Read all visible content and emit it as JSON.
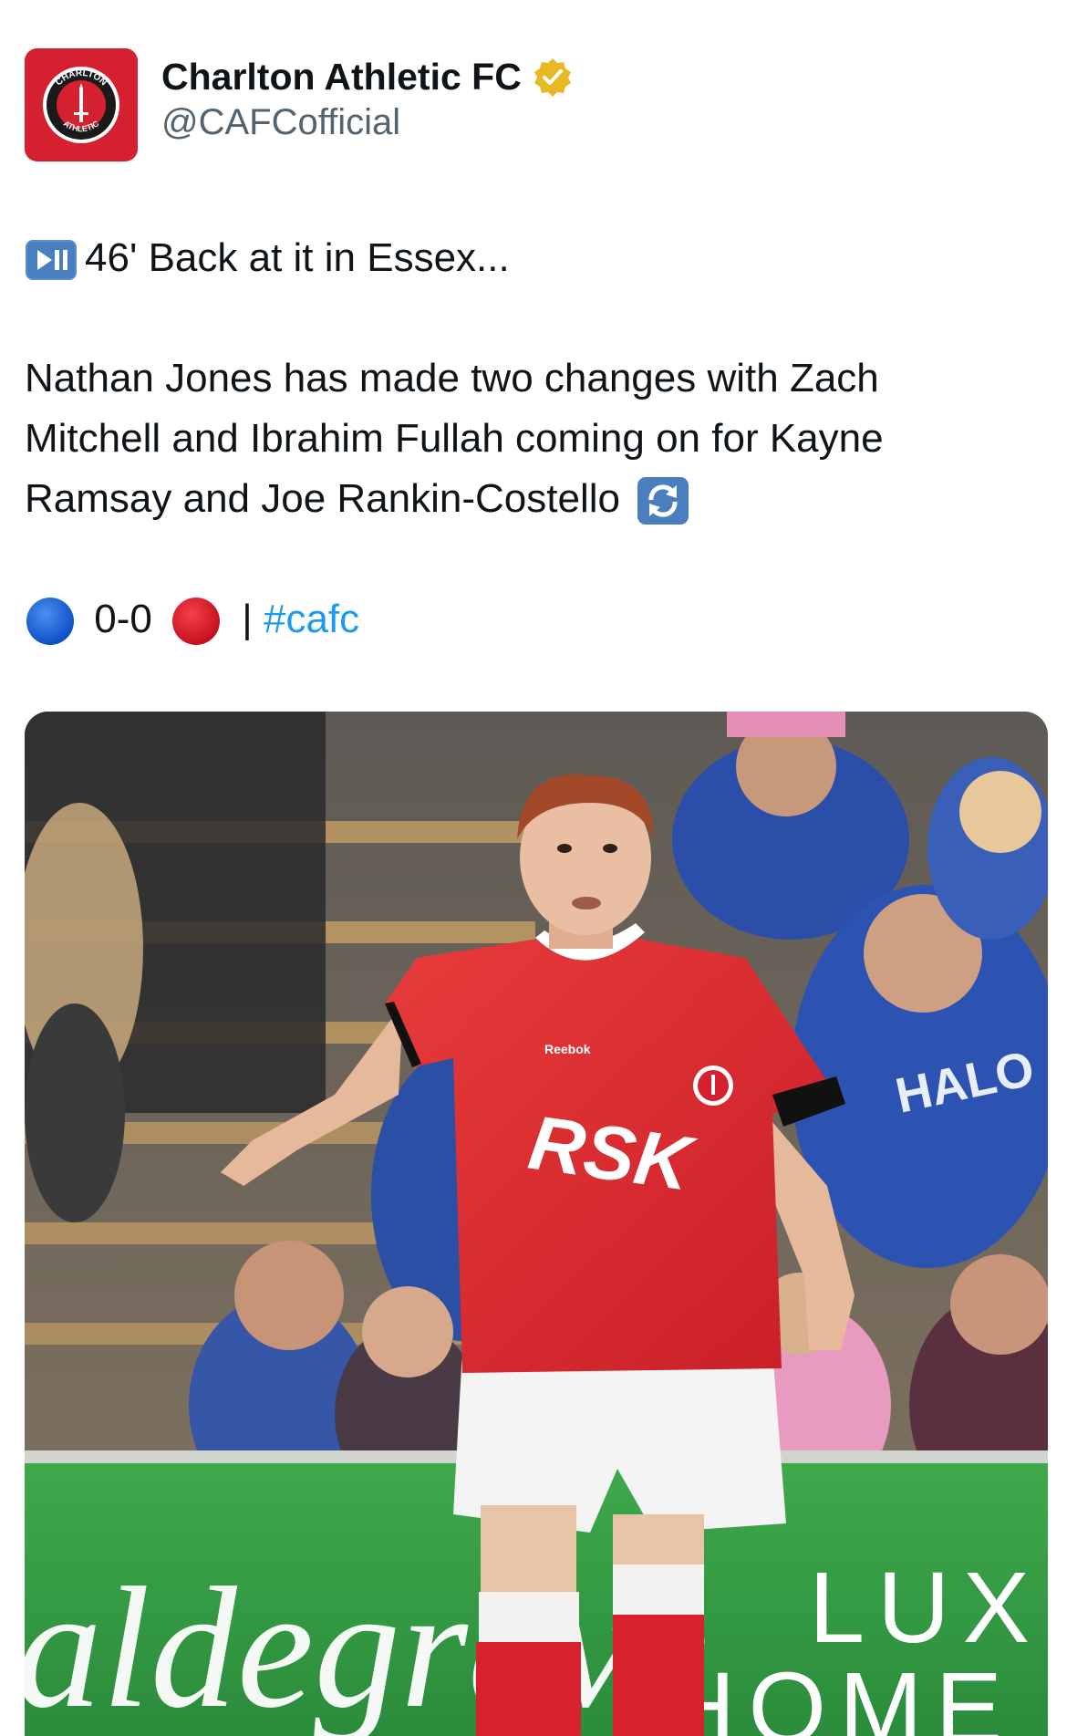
{
  "account": {
    "display_name": "Charlton Athletic FC",
    "handle": "@CAFCofficial",
    "verified": true,
    "avatar_icon": "charlton-crest-icon",
    "avatar_text_top": "CHARLTON",
    "avatar_text_bottom": "ATHLETIC"
  },
  "tweet": {
    "line1": "46' Back at it in Essex...",
    "line2": "Nathan Jones has made two changes with Zach",
    "line3": "Mitchell and Ibrahim Fullah coming on for Kayne",
    "line4": "Ramsay and Joe Rankin-Costello",
    "score": "0-0",
    "separator": "|",
    "hashtag": "#cafc"
  },
  "media": {
    "shirt_sponsor": "RSK",
    "kit_maker": "Reebok",
    "board_text": "aldegrave",
    "board_text_right_1": "LUX",
    "board_text_right_2": "HOME",
    "fan_shirt_sponsor": "HALO"
  },
  "colors": {
    "accent_link": "#1d9bf0",
    "club_red": "#d4202f",
    "verified_gold": "#e8b923"
  }
}
